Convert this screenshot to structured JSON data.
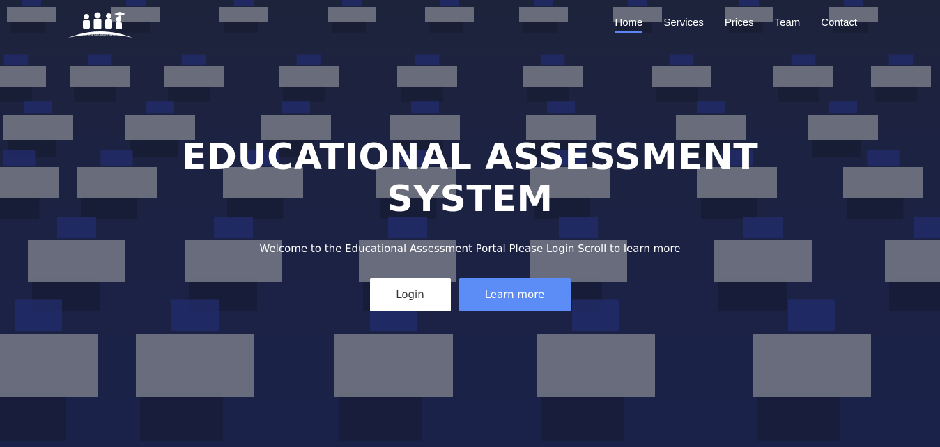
{
  "header": {
    "logo_icon": "graduates-logo-icon",
    "logo_caption": "Online Smart Exam System",
    "nav": [
      {
        "label": "Home",
        "active": true
      },
      {
        "label": "Services",
        "active": false
      },
      {
        "label": "Prices",
        "active": false
      },
      {
        "label": "Team",
        "active": false
      },
      {
        "label": "Contact",
        "active": false
      }
    ]
  },
  "hero": {
    "title_line1": "EDUCATIONAL ASSESSMENT",
    "title_line2": "SYSTEM",
    "subtitle": "Welcome to the Educational Assessment Portal Please Login Scroll to learn more",
    "login_label": "Login",
    "learn_more_label": "Learn more",
    "background": "exam-hall-photo"
  },
  "colors": {
    "accent": "#5c8df6",
    "nav_underline": "#5c86f7",
    "text": "#ffffff"
  }
}
